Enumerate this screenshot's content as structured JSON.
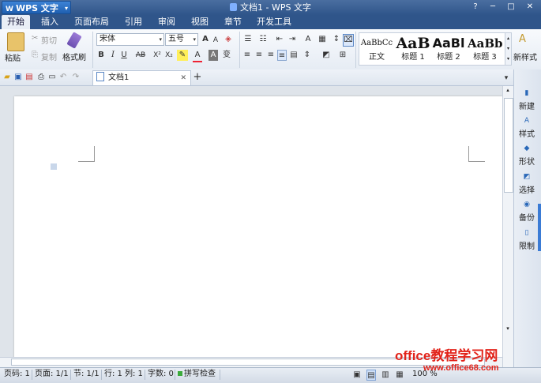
{
  "titlebar": {
    "app_menu": "WPS 文字",
    "window_title": "文档1 - WPS 文字",
    "help": "?",
    "minimize": "─",
    "maximize": "□",
    "close": "✕"
  },
  "tabs": [
    "开始",
    "插入",
    "页面布局",
    "引用",
    "审阅",
    "视图",
    "章节",
    "开发工具"
  ],
  "active_tab": "开始",
  "ribbon": {
    "paste": "粘贴",
    "cut": "剪切",
    "copy": "复制",
    "format_painter": "格式刷",
    "font_name": "宋体",
    "font_size": "五号",
    "styles": [
      {
        "preview": "AaBbCc",
        "label": "正文"
      },
      {
        "preview": "AaB",
        "label": "标题 1"
      },
      {
        "preview": "AaBl",
        "label": "标题 2"
      },
      {
        "preview": "AaBb",
        "label": "标题 3"
      }
    ],
    "new_style": "新样式"
  },
  "doc_tab": {
    "label": "文档1",
    "close": "✕",
    "new": "+"
  },
  "right_panel": [
    "新建",
    "样式",
    "形状",
    "选择",
    "备份",
    "限制"
  ],
  "status": {
    "page_code": "页码: 1",
    "pages": "页面: 1/1",
    "section": "节: 1/1",
    "row": "行: 1",
    "col": "列: 1",
    "word_count": "字数: 0",
    "spell_check": "拼写检查",
    "zoom": "100 %"
  },
  "watermark": {
    "line1": "office教程学习网",
    "line2": "www.office68.com"
  },
  "colors": {
    "title_bg": "#2f558a",
    "accent": "#3d83d6",
    "watermark": "#e2231a"
  }
}
